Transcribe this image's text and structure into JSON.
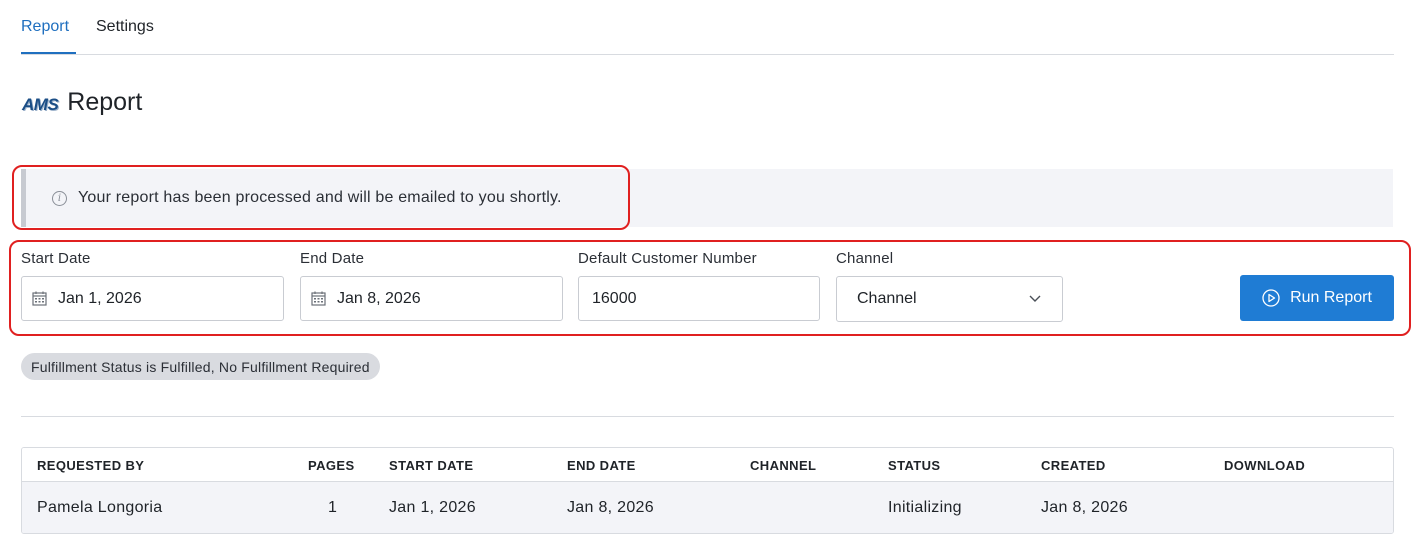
{
  "tabs": [
    {
      "label": "Report",
      "active": true
    },
    {
      "label": "Settings",
      "active": false
    }
  ],
  "page": {
    "logo_text": "AMS",
    "title": "Report"
  },
  "alert": {
    "icon": "info-icon",
    "message": "Your report has been processed and will be emailed to you shortly."
  },
  "form": {
    "start_date": {
      "label": "Start Date",
      "value": "Jan 1, 2026",
      "icon": "calendar-icon"
    },
    "end_date": {
      "label": "End Date",
      "value": "Jan 8, 2026",
      "icon": "calendar-icon"
    },
    "customer_number": {
      "label": "Default Customer Number",
      "value": "16000"
    },
    "channel": {
      "label": "Channel",
      "selected": "Channel",
      "icon": "chevron-down-icon"
    },
    "run_button": {
      "label": "Run Report",
      "icon": "play-circle-icon"
    }
  },
  "filter_chip": "Fulfillment Status is Fulfilled, No Fulfillment Required",
  "table": {
    "columns": [
      "REQUESTED BY",
      "PAGES",
      "START DATE",
      "END DATE",
      "CHANNEL",
      "STATUS",
      "CREATED",
      "DOWNLOAD"
    ],
    "rows": [
      {
        "requested_by": "Pamela Longoria",
        "pages": "1",
        "start_date": "Jan 1, 2026",
        "end_date": "Jan 8, 2026",
        "channel": "",
        "status": "Initializing",
        "created": "Jan 8, 2026",
        "download": ""
      }
    ]
  },
  "colors": {
    "accent": "#1f7cd4",
    "tab_active": "#1f6fbf",
    "highlight_outline": "#e02020",
    "alert_bg": "#f3f4f8"
  }
}
